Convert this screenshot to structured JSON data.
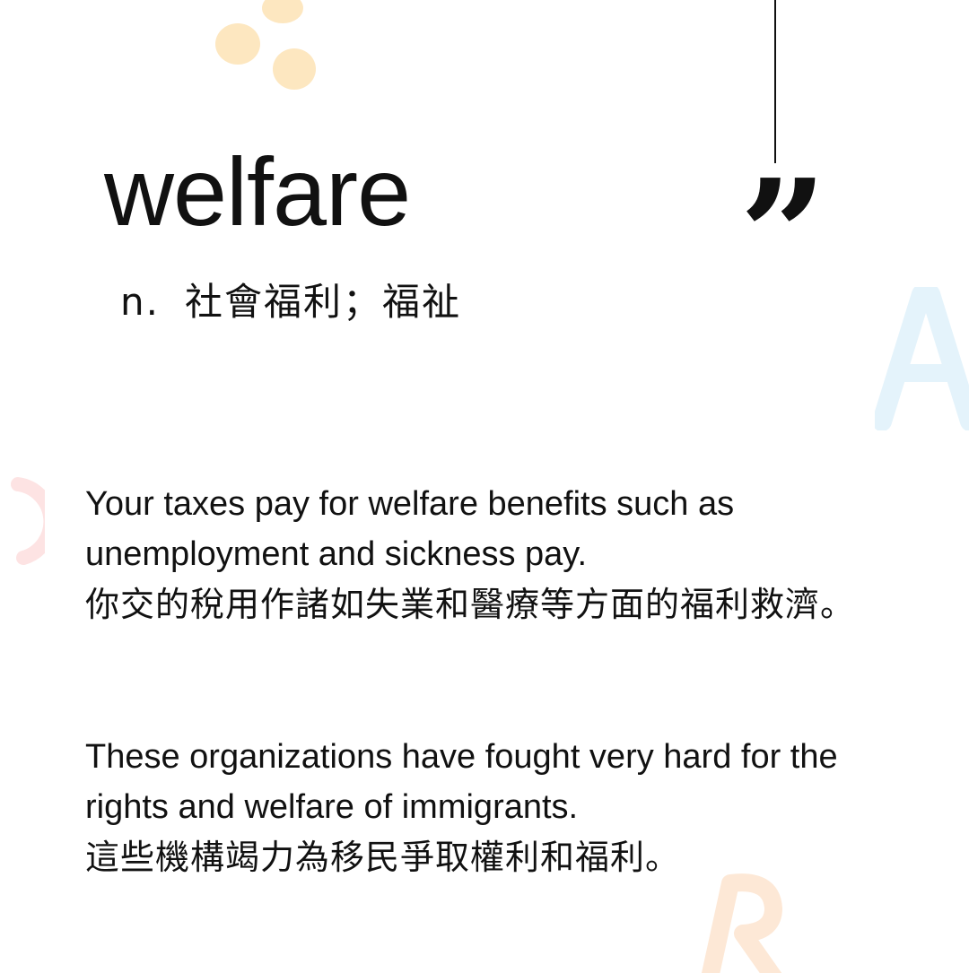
{
  "colors": {
    "text": "#111111",
    "background": "#ffffff",
    "dot": "#fde7c0",
    "letter_a": "#e4f3fb",
    "letter_c": "#fde3e3",
    "letter_b": "#fde8d6"
  },
  "decorations": {
    "letter_a": "A",
    "letter_c": "C",
    "letter_b": "R",
    "quote_glyph": "”"
  },
  "entry": {
    "word": "welfare",
    "part_of_speech": "n.",
    "definition": "社會福利；福祉"
  },
  "examples": [
    {
      "en": "Your taxes pay for welfare benefits such as unemployment and sickness pay.",
      "zh": "你交的稅用作諸如失業和醫療等方面的福利救濟。"
    },
    {
      "en": "These organizations have fought very hard for the rights and welfare of immigrants.",
      "zh": "這些機構竭力為移民爭取權利和福利。"
    }
  ]
}
